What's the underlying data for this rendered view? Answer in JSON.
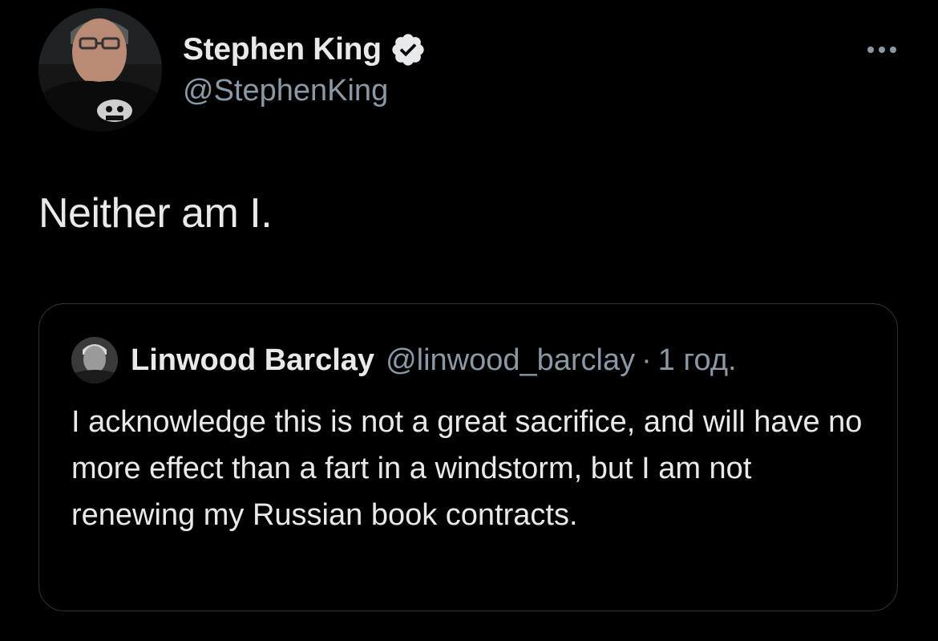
{
  "tweet": {
    "author": {
      "display_name": "Stephen King",
      "handle": "@StephenKing",
      "verified": true,
      "avatar": "stephen-king-avatar"
    },
    "text": "Neither am I.",
    "more_icon": "more-horizontal-icon",
    "quoted": {
      "author": {
        "display_name": "Linwood Barclay",
        "handle": "@linwood_barclay",
        "avatar": "linwood-barclay-avatar"
      },
      "separator": "·",
      "timestamp": "1 год.",
      "text": "I acknowledge this is not a great sacrifice, and will have no more effect than a fart in a windstorm, but I am not renewing my Russian book contracts."
    }
  },
  "colors": {
    "background": "#000000",
    "primary_text": "#e7e9ea",
    "secondary_text": "#8b98a5",
    "border": "#2f3336",
    "verified_badge": "#e7e9ea"
  }
}
